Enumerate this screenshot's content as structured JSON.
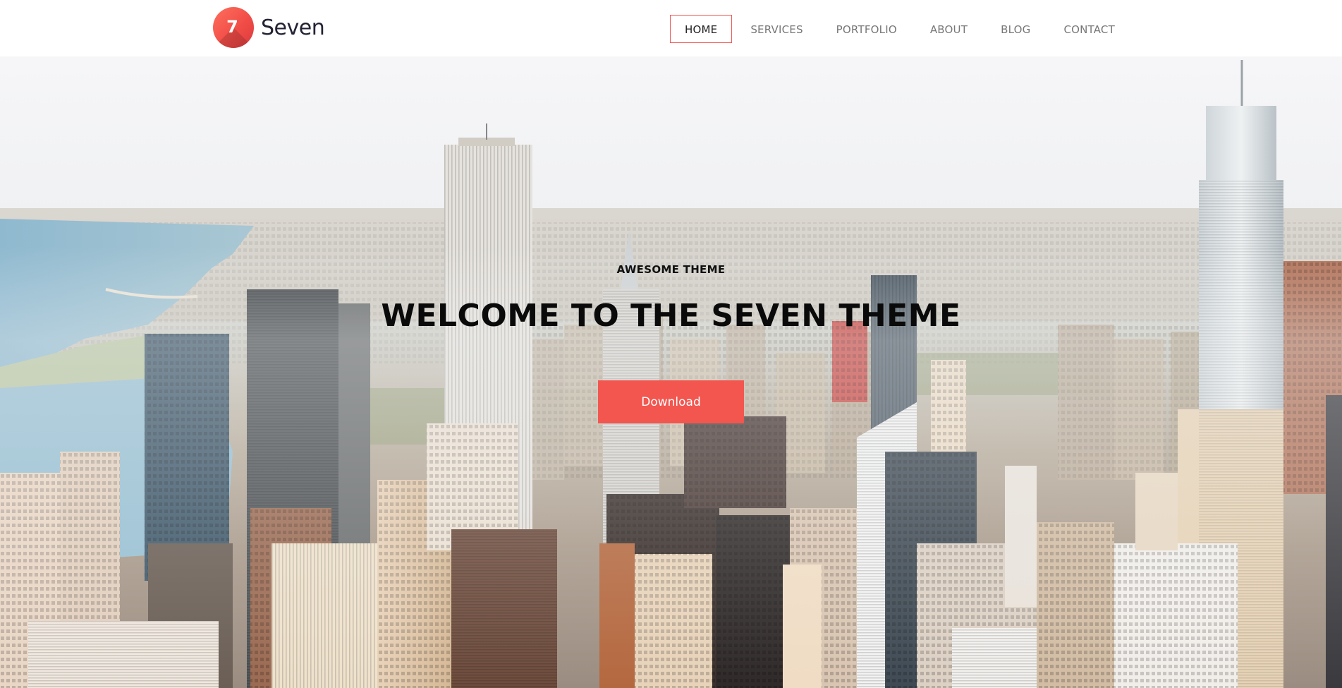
{
  "brand": {
    "logo_digit": "7",
    "name": "Seven",
    "accent_color": "#f2564f"
  },
  "nav": {
    "items": [
      {
        "label": "HOME",
        "active": true
      },
      {
        "label": "SERVICES",
        "active": false
      },
      {
        "label": "PORTFOLIO",
        "active": false
      },
      {
        "label": "ABOUT",
        "active": false
      },
      {
        "label": "BLOG",
        "active": false
      },
      {
        "label": "CONTACT",
        "active": false
      }
    ]
  },
  "hero": {
    "background_image": "city-skyline-photo",
    "subtitle": "AWESOME THEME",
    "title": "WELCOME TO THE SEVEN THEME",
    "button_label": "Download"
  }
}
